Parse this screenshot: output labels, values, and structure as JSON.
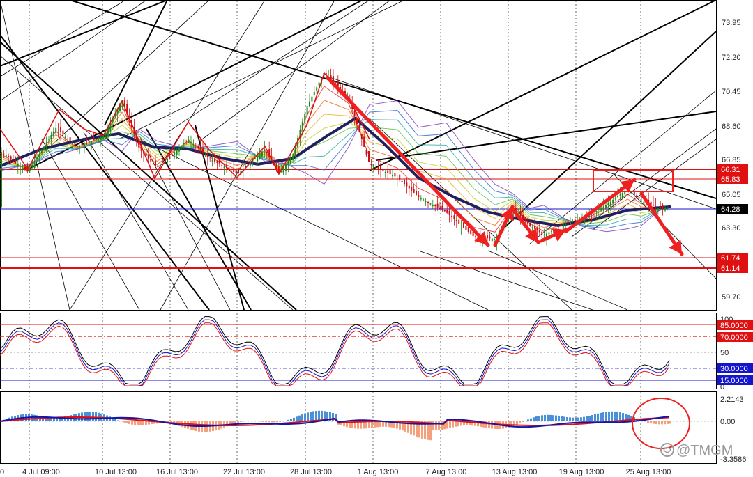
{
  "chart_data": [
    {
      "type": "candlestick",
      "panel": "price",
      "x_ticks": [
        "4 Jul 09:00",
        "10 Jul 13:00",
        "16 Jul 13:00",
        "22 Jul 13:00",
        "28 Jul 13:00",
        "1 Aug 13:00",
        "7 Aug 13:00",
        "13 Aug 13:00",
        "19 Aug 13:00",
        "25 Aug 13:00"
      ],
      "y_ticks": [
        "73.95",
        "72.20",
        "70.45",
        "68.60",
        "66.85",
        "65.05",
        "63.30",
        "59.70"
      ],
      "ylim": [
        59.7,
        73.95
      ],
      "current_price": "64.28",
      "levels": [
        {
          "label": "66.31",
          "color": "#e01010"
        },
        {
          "label": "65.83",
          "color": "#e01010"
        },
        {
          "label": "61.74",
          "color": "#e01010"
        },
        {
          "label": "61.14",
          "color": "#e01010"
        }
      ],
      "path_points": [
        [
          0,
          67.2
        ],
        [
          40,
          66.1
        ],
        [
          80,
          68.4
        ],
        [
          110,
          67.4
        ],
        [
          150,
          68.0
        ],
        [
          175,
          69.9
        ],
        [
          200,
          67.3
        ],
        [
          225,
          66.3
        ],
        [
          270,
          67.8
        ],
        [
          300,
          66.8
        ],
        [
          340,
          66.0
        ],
        [
          380,
          67.3
        ],
        [
          400,
          66.0
        ],
        [
          420,
          67.0
        ],
        [
          440,
          69.5
        ],
        [
          465,
          71.3
        ],
        [
          500,
          70.0
        ],
        [
          530,
          66.5
        ],
        [
          570,
          65.8
        ],
        [
          600,
          64.8
        ],
        [
          640,
          64.0
        ],
        [
          680,
          62.7
        ],
        [
          710,
          62.6
        ],
        [
          735,
          64.2
        ],
        [
          760,
          63.3
        ],
        [
          780,
          62.8
        ],
        [
          810,
          63.4
        ],
        [
          840,
          63.7
        ],
        [
          870,
          64.4
        ],
        [
          900,
          65.2
        ],
        [
          920,
          64.6
        ],
        [
          945,
          64.2
        ],
        [
          962,
          64.28
        ]
      ],
      "ma_path": [
        [
          0,
          66.4
        ],
        [
          60,
          67.3
        ],
        [
          120,
          67.8
        ],
        [
          170,
          68.1
        ],
        [
          220,
          67.4
        ],
        [
          270,
          67.3
        ],
        [
          320,
          66.8
        ],
        [
          370,
          66.5
        ],
        [
          420,
          66.8
        ],
        [
          470,
          68.0
        ],
        [
          510,
          68.9
        ],
        [
          550,
          67.6
        ],
        [
          600,
          65.8
        ],
        [
          650,
          64.8
        ],
        [
          700,
          64.0
        ],
        [
          750,
          63.6
        ],
        [
          800,
          63.3
        ],
        [
          850,
          63.6
        ],
        [
          900,
          64.1
        ],
        [
          962,
          64.28
        ]
      ]
    },
    {
      "type": "line",
      "panel": "stochastic",
      "y_ticks": [
        "100",
        "85.0000",
        "70.0000",
        "50",
        "30.0000",
        "15.0000",
        "0"
      ],
      "ylim": [
        0,
        100
      ],
      "levels": [
        85,
        70,
        30,
        15
      ]
    },
    {
      "type": "histogram",
      "panel": "macd",
      "y_ticks": [
        "2.2143",
        "0.00",
        "-3.3586"
      ],
      "ylim": [
        -3.3586,
        2.2143
      ]
    }
  ],
  "watermark": "@TMGM",
  "watermark_logo": "tmgm-logo-icon",
  "colors": {
    "level_red": "#e01010",
    "price_blue": "#1515cc",
    "ma_navy": "#202060",
    "hist_blue": "#4a90d9",
    "hist_orange": "#f4a07a",
    "callout_red": "#f02020"
  }
}
